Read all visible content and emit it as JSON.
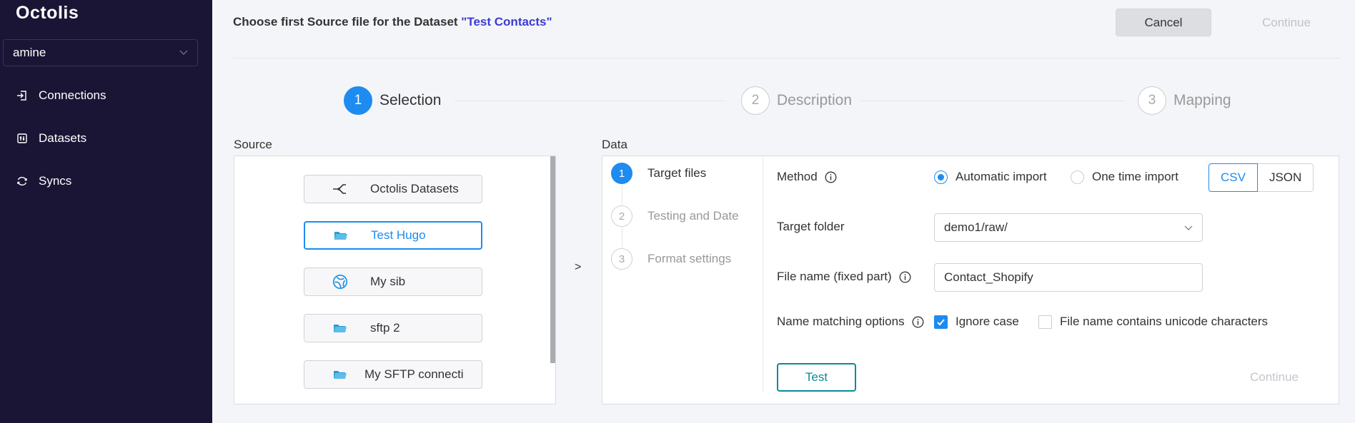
{
  "app": {
    "logo": "Octolis"
  },
  "sidebar": {
    "account": "amine",
    "items": [
      {
        "label": "Connections",
        "icon": "login-icon"
      },
      {
        "label": "Datasets",
        "icon": "dataset-icon"
      },
      {
        "label": "Syncs",
        "icon": "sync-icon"
      }
    ]
  },
  "header": {
    "title_prefix": "Choose first Source file for the Dataset ",
    "dataset_name": "\"Test Contacts\"",
    "cancel_label": "Cancel",
    "continue_label": "Continue"
  },
  "stepper": [
    {
      "number": "1",
      "label": "Selection",
      "active": true
    },
    {
      "number": "2",
      "label": "Description",
      "active": false
    },
    {
      "number": "3",
      "label": "Mapping",
      "active": false
    }
  ],
  "source": {
    "label": "Source",
    "items": [
      {
        "label": "Octolis Datasets",
        "icon": "octolis-datasets-icon",
        "selected": false
      },
      {
        "label": "Test Hugo",
        "icon": "sftp-folder-icon",
        "selected": true
      },
      {
        "label": "My sib",
        "icon": "sendinblue-icon",
        "selected": false
      },
      {
        "label": "sftp 2",
        "icon": "sftp-folder-icon",
        "selected": false
      },
      {
        "label": "My SFTP connecti",
        "icon": "sftp-folder-icon",
        "selected": false
      }
    ]
  },
  "arrow": ">",
  "data": {
    "label": "Data",
    "sub_steps": [
      {
        "number": "1",
        "label": "Target files",
        "active": true
      },
      {
        "number": "2",
        "label": "Testing and Date",
        "active": false
      },
      {
        "number": "3",
        "label": "Format settings",
        "active": false
      }
    ],
    "method": {
      "label": "Method",
      "options": [
        "Automatic import",
        "One time import"
      ],
      "selected": "Automatic import",
      "formats": [
        "CSV",
        "JSON"
      ],
      "selected_format": "CSV"
    },
    "target_folder": {
      "label": "Target folder",
      "value": "demo1/raw/"
    },
    "file_name": {
      "label": "File name (fixed part)",
      "value": "Contact_Shopify"
    },
    "name_matching": {
      "label": "Name matching options",
      "ignore_case": {
        "label": "Ignore case",
        "checked": true
      },
      "unicode": {
        "label": "File name contains unicode characters",
        "checked": false
      }
    },
    "test_label": "Test",
    "continue_label": "Continue"
  },
  "colors": {
    "sidebar_bg": "#1a1535",
    "accent": "#1d8bf0",
    "dataset_name": "#3b3bd6",
    "test_button": "#0c8a96"
  }
}
